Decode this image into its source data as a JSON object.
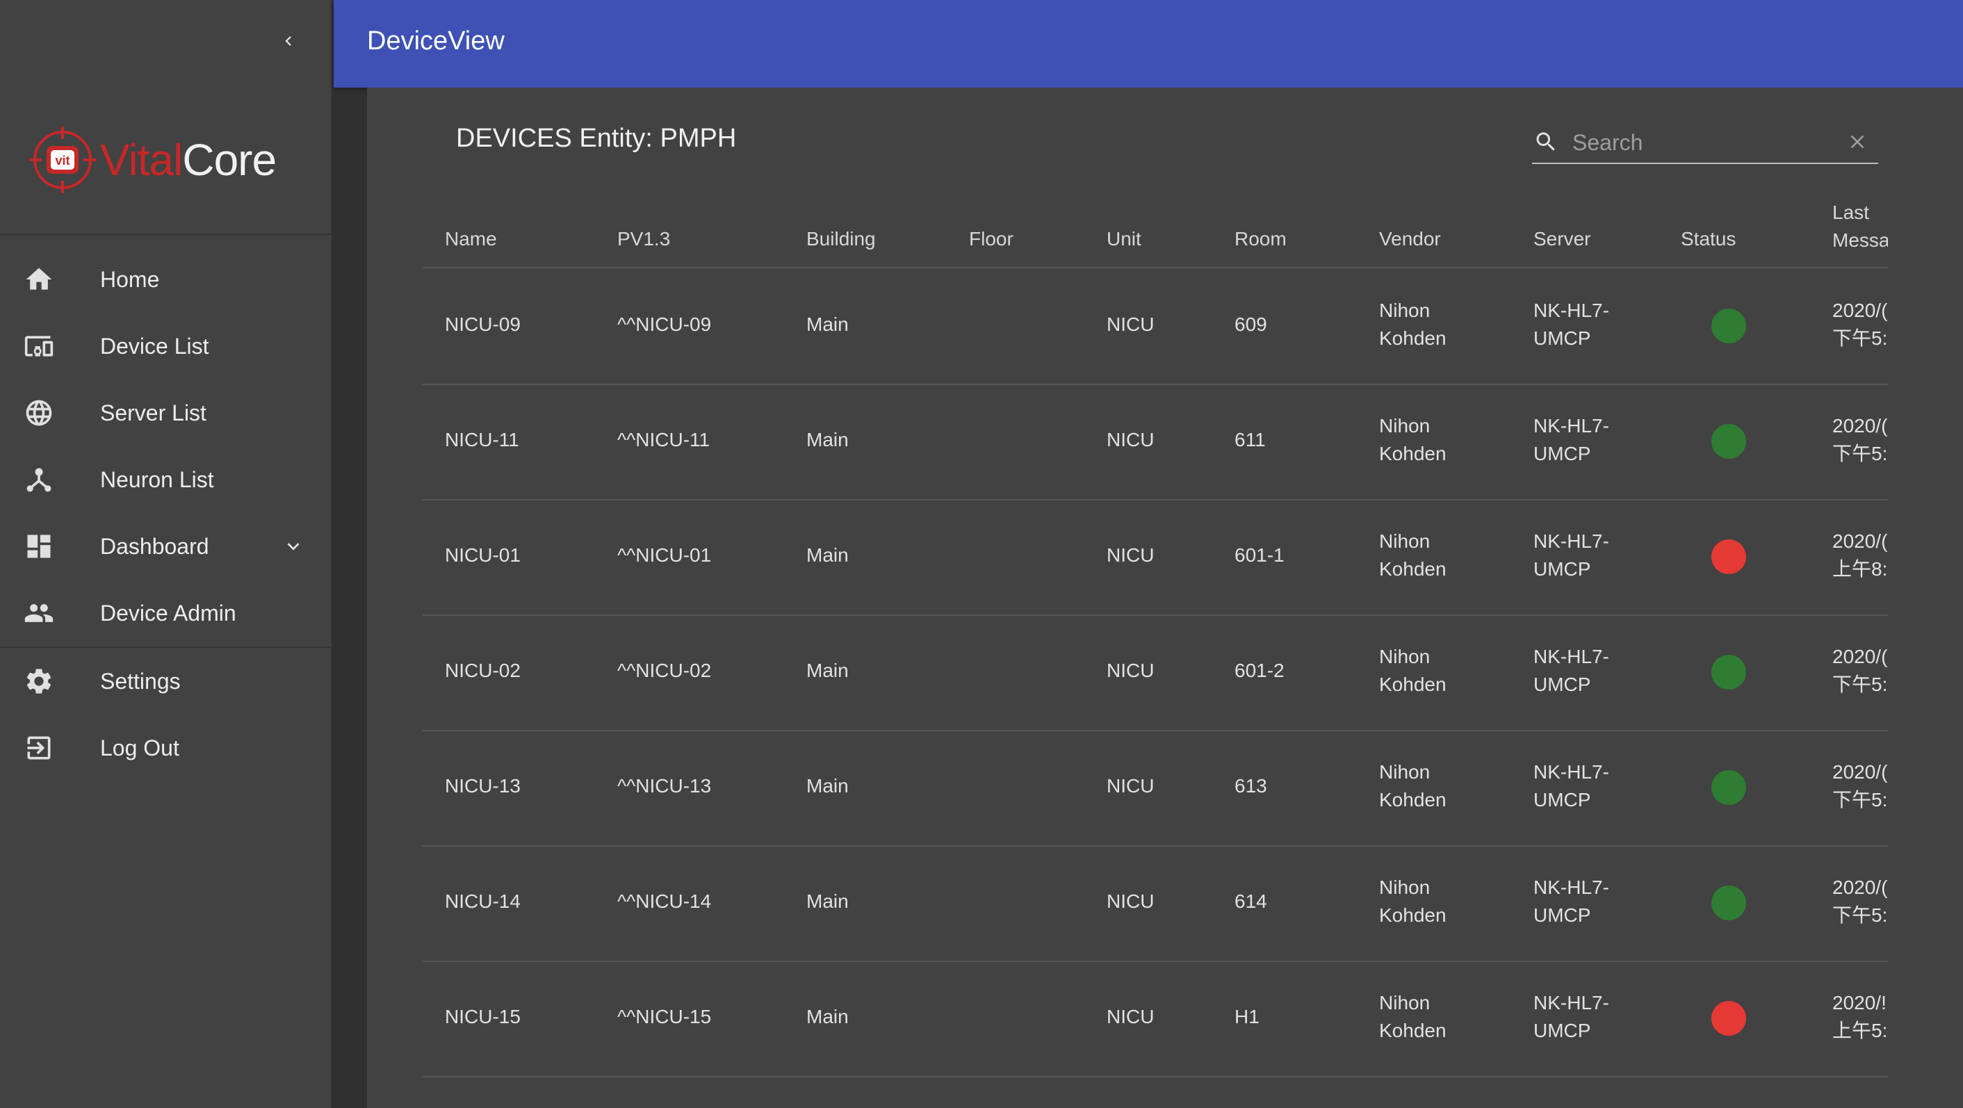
{
  "app": {
    "title": "DeviceView",
    "logo_parts": [
      "Vital",
      "Core"
    ],
    "logo_badge": "vit"
  },
  "sidebar": {
    "items": [
      {
        "label": "Home",
        "icon": "home-icon"
      },
      {
        "label": "Device List",
        "icon": "devices-icon"
      },
      {
        "label": "Server List",
        "icon": "globe-icon"
      },
      {
        "label": "Neuron List",
        "icon": "hub-icon"
      },
      {
        "label": "Dashboard",
        "icon": "dashboard-icon",
        "expandable": true
      },
      {
        "label": "Device Admin",
        "icon": "people-icon"
      },
      {
        "label": "Settings",
        "icon": "gear-icon"
      },
      {
        "label": "Log Out",
        "icon": "logout-icon"
      }
    ]
  },
  "page": {
    "title": "DEVICES Entity: PMPH"
  },
  "search": {
    "placeholder": "Search",
    "value": ""
  },
  "table": {
    "columns": [
      "Name",
      "PV1.3",
      "Building",
      "Floor",
      "Unit",
      "Room",
      "Vendor",
      "Server",
      "Status",
      "Last Messa"
    ],
    "last_col_header_lines": [
      "Last",
      "Messa"
    ],
    "rows": [
      {
        "name": "NICU-09",
        "pv13": "^^NICU-09",
        "building": "Main",
        "floor": "",
        "unit": "NICU",
        "room": "609",
        "vendor": [
          "Nihon",
          "Kohden"
        ],
        "server": [
          "NK-HL7-",
          "UMCP"
        ],
        "status": "online",
        "last": [
          "2020/(",
          "下午5:"
        ]
      },
      {
        "name": "NICU-11",
        "pv13": "^^NICU-11",
        "building": "Main",
        "floor": "",
        "unit": "NICU",
        "room": "611",
        "vendor": [
          "Nihon",
          "Kohden"
        ],
        "server": [
          "NK-HL7-",
          "UMCP"
        ],
        "status": "online",
        "last": [
          "2020/(",
          "下午5:"
        ]
      },
      {
        "name": "NICU-01",
        "pv13": "^^NICU-01",
        "building": "Main",
        "floor": "",
        "unit": "NICU",
        "room": "601-1",
        "vendor": [
          "Nihon",
          "Kohden"
        ],
        "server": [
          "NK-HL7-",
          "UMCP"
        ],
        "status": "offline",
        "last": [
          "2020/(",
          "上午8:"
        ]
      },
      {
        "name": "NICU-02",
        "pv13": "^^NICU-02",
        "building": "Main",
        "floor": "",
        "unit": "NICU",
        "room": "601-2",
        "vendor": [
          "Nihon",
          "Kohden"
        ],
        "server": [
          "NK-HL7-",
          "UMCP"
        ],
        "status": "online",
        "last": [
          "2020/(",
          "下午5:"
        ]
      },
      {
        "name": "NICU-13",
        "pv13": "^^NICU-13",
        "building": "Main",
        "floor": "",
        "unit": "NICU",
        "room": "613",
        "vendor": [
          "Nihon",
          "Kohden"
        ],
        "server": [
          "NK-HL7-",
          "UMCP"
        ],
        "status": "online",
        "last": [
          "2020/(",
          "下午5:"
        ]
      },
      {
        "name": "NICU-14",
        "pv13": "^^NICU-14",
        "building": "Main",
        "floor": "",
        "unit": "NICU",
        "room": "614",
        "vendor": [
          "Nihon",
          "Kohden"
        ],
        "server": [
          "NK-HL7-",
          "UMCP"
        ],
        "status": "online",
        "last": [
          "2020/(",
          "下午5:"
        ]
      },
      {
        "name": "NICU-15",
        "pv13": "^^NICU-15",
        "building": "Main",
        "floor": "",
        "unit": "NICU",
        "room": "H1",
        "vendor": [
          "Nihon",
          "Kohden"
        ],
        "server": [
          "NK-HL7-",
          "UMCP"
        ],
        "status": "offline",
        "last": [
          "2020/!",
          "上午5:"
        ]
      }
    ]
  },
  "colors": {
    "appbar": "#3f51b5",
    "status_online": "#2e7d32",
    "status_offline": "#e53935",
    "brand_red": "#c62828"
  }
}
